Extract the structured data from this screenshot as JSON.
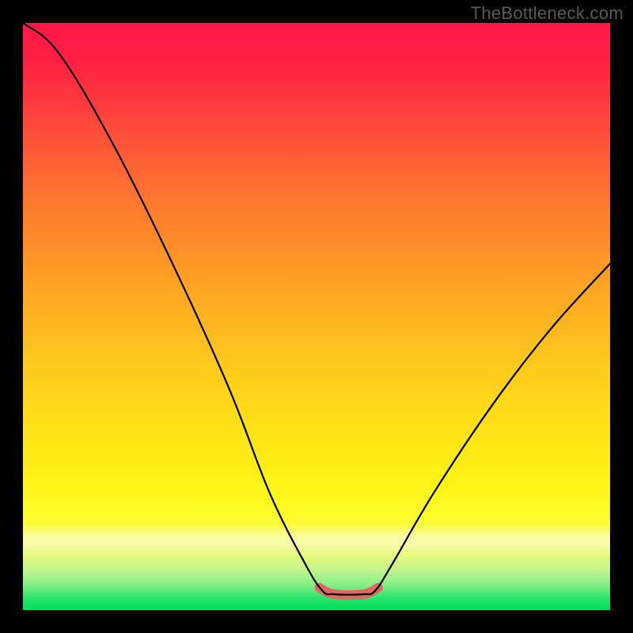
{
  "watermark": "TheBottleneck.com",
  "chart_data": {
    "type": "line",
    "title": "",
    "xlabel": "",
    "ylabel": "",
    "xlim": [
      0,
      100
    ],
    "ylim": [
      0,
      100
    ],
    "grid": false,
    "legend": false,
    "background_gradient": {
      "direction": "vertical",
      "stops": [
        {
          "pos": 0,
          "color": "#ff1848"
        },
        {
          "pos": 50,
          "color": "#ffb020"
        },
        {
          "pos": 80,
          "color": "#fff314"
        },
        {
          "pos": 100,
          "color": "#00de5e"
        }
      ]
    },
    "series": [
      {
        "name": "v-curve",
        "note": "Bottleneck-style V curve; y is visual height (0=bottom, 100=top). Approximated from pixels.",
        "points": [
          {
            "x": 0,
            "y": 100
          },
          {
            "x": 6,
            "y": 95
          },
          {
            "x": 15,
            "y": 80
          },
          {
            "x": 25,
            "y": 60
          },
          {
            "x": 35,
            "y": 38
          },
          {
            "x": 42,
            "y": 20
          },
          {
            "x": 48,
            "y": 8
          },
          {
            "x": 51,
            "y": 3.3
          },
          {
            "x": 53,
            "y": 2.7
          },
          {
            "x": 58,
            "y": 2.7
          },
          {
            "x": 60,
            "y": 3.3
          },
          {
            "x": 63,
            "y": 8
          },
          {
            "x": 70,
            "y": 20
          },
          {
            "x": 80,
            "y": 35
          },
          {
            "x": 90,
            "y": 48
          },
          {
            "x": 100,
            "y": 59
          }
        ]
      },
      {
        "name": "valley-highlight",
        "color": "#e06a62",
        "stroke_width_px": 10,
        "note": "Thick pinkish stroke over the valley floor segment",
        "points": [
          {
            "x": 50.5,
            "y": 3.8
          },
          {
            "x": 53,
            "y": 2.7
          },
          {
            "x": 58,
            "y": 2.7
          },
          {
            "x": 60.5,
            "y": 3.8
          }
        ]
      }
    ]
  }
}
